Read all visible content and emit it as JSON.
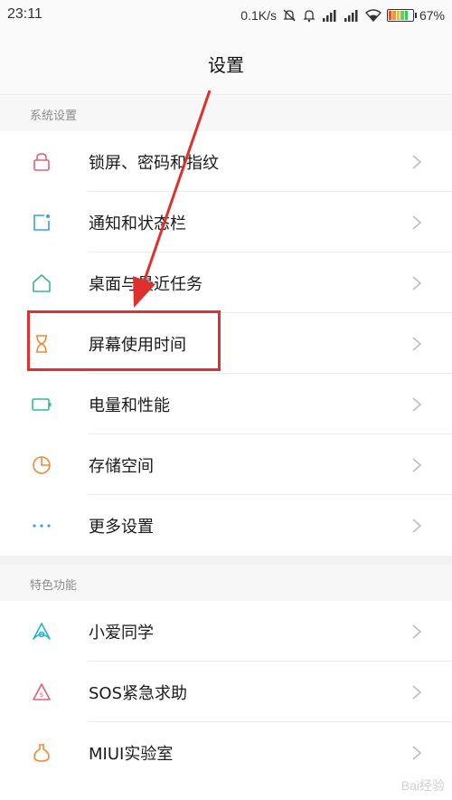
{
  "status_bar": {
    "time": "23:11",
    "network_speed": "0.1K/s",
    "battery_percent": "67%",
    "battery_level": 0.67
  },
  "header": {
    "title": "设置"
  },
  "sections": [
    {
      "title": "系统设置",
      "items": [
        {
          "label": "锁屏、密码和指纹",
          "icon": "lock-icon"
        },
        {
          "label": "通知和状态栏",
          "icon": "notification-icon"
        },
        {
          "label": "桌面与最近任务",
          "icon": "home-icon"
        },
        {
          "label": "屏幕使用时间",
          "icon": "hourglass-icon"
        },
        {
          "label": "电量和性能",
          "icon": "battery-icon"
        },
        {
          "label": "存储空间",
          "icon": "storage-icon"
        },
        {
          "label": "更多设置",
          "icon": "more-icon"
        }
      ]
    },
    {
      "title": "特色功能",
      "items": [
        {
          "label": "小爱同学",
          "icon": "xiaoai-icon"
        },
        {
          "label": "SOS紧急求助",
          "icon": "sos-icon"
        },
        {
          "label": "MIUI实验室",
          "icon": "lab-flask-icon"
        }
      ]
    }
  ],
  "colors": {
    "highlight": "#e0302e",
    "lock": "#e0607a",
    "notification": "#3a9ee8",
    "home": "#3bb39a",
    "hourglass": "#f08a3c",
    "battery": "#2fbf8f",
    "storage": "#f08a3c",
    "more": "#3a9ee8",
    "xiaoai": "#22b3c9",
    "sos": "#e0607a",
    "lab": "#f08a3c"
  },
  "watermark": "Bai经验"
}
